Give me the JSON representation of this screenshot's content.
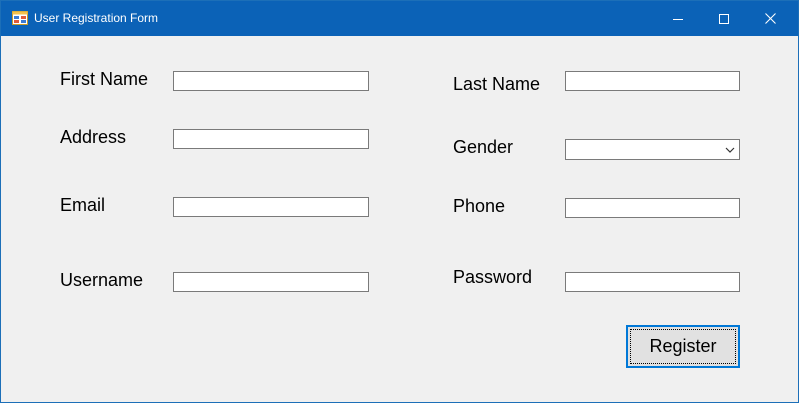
{
  "window": {
    "title": "User Registration Form",
    "icons": {
      "app": "form-app-icon",
      "minimize": "minimize-icon",
      "maximize": "maximize-icon",
      "close": "close-icon"
    },
    "colors": {
      "titlebar": "#0b62b7",
      "client": "#f0f0f0",
      "focus": "#0078d7"
    }
  },
  "form": {
    "first_name": {
      "label": "First Name",
      "value": ""
    },
    "last_name": {
      "label": "Last Name",
      "value": ""
    },
    "address": {
      "label": "Address",
      "value": ""
    },
    "gender": {
      "label": "Gender",
      "value": ""
    },
    "email": {
      "label": "Email",
      "value": ""
    },
    "phone": {
      "label": "Phone",
      "value": ""
    },
    "username": {
      "label": "Username",
      "value": ""
    },
    "password": {
      "label": "Password",
      "value": ""
    },
    "register_label": "Register"
  }
}
